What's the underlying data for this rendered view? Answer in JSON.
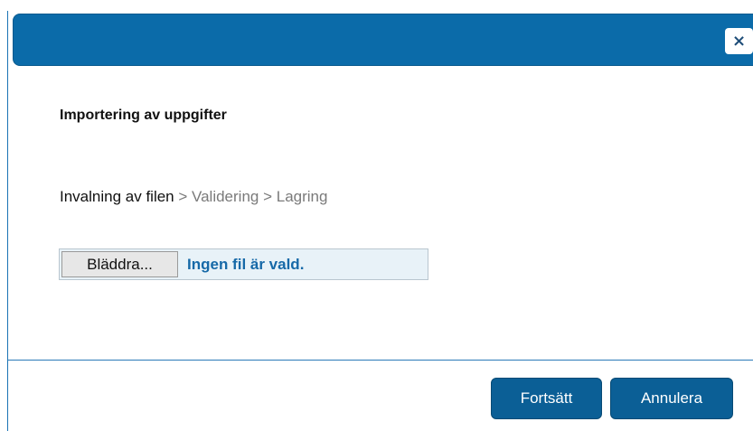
{
  "dialog": {
    "close_icon": "×"
  },
  "content": {
    "heading": "Importering av uppgifter",
    "steps": {
      "active": "Invalning av filen",
      "separator1": " > ",
      "step2": "Validering",
      "separator2": " > ",
      "step3": "Lagring"
    },
    "file_input": {
      "browse_label": "Bläddra...",
      "status": "Ingen fil är vald."
    }
  },
  "footer": {
    "continue_label": "Fortsätt",
    "cancel_label": "Annulera"
  },
  "colors": {
    "titlebar": "#0b6ba9",
    "button": "#0b5f96",
    "file_status_text": "#1669a8"
  }
}
